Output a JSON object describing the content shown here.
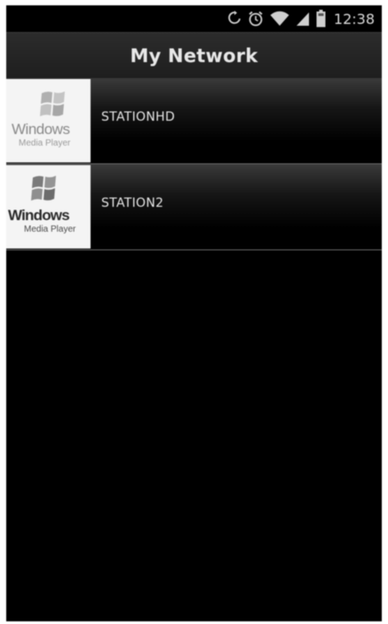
{
  "status_bar": {
    "icons": [
      "sync-icon",
      "alarm-icon",
      "wifi-icon",
      "signal-icon",
      "battery-icon"
    ],
    "time": "12:38"
  },
  "app_bar": {
    "title": "My Network"
  },
  "devices": [
    {
      "name": "STATIONHD",
      "icon": "windows-media-player-icon"
    },
    {
      "name": "STATION2",
      "icon": "windows-media-player-icon"
    }
  ],
  "colors": {
    "background": "#000000",
    "title_bar": "#262626",
    "text": "#e6e6e6",
    "thumbnail_bg": "#f4f4f4"
  }
}
